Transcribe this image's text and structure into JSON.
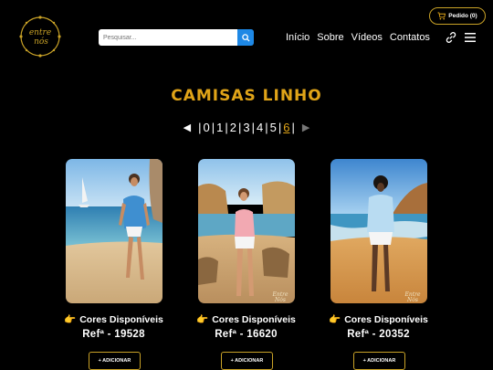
{
  "header": {
    "logo_text": "entre nós",
    "search_placeholder": "Pesquisar...",
    "nav": [
      "Início",
      "Sobre",
      "Vídeos",
      "Contatos"
    ],
    "order_label": "Pedido (0)"
  },
  "page": {
    "title": "CAMISAS LINHO",
    "pagination": {
      "pages": [
        "0",
        "1",
        "2",
        "3",
        "4",
        "5",
        "6"
      ],
      "current": "6",
      "separator": "|"
    }
  },
  "products": [
    {
      "colors_label": "Cores Disponíveis",
      "ref": "Refª - 19528",
      "add_label": "+ ADICIONAR"
    },
    {
      "colors_label": "Cores Disponíveis",
      "ref": "Refª - 16620",
      "add_label": "+ ADICIONAR"
    },
    {
      "colors_label": "Cores Disponíveis",
      "ref": "Refª - 20352",
      "add_label": "+ ADICIONAR"
    }
  ],
  "colors": {
    "accent": "#e0a418",
    "border": "#c9a227",
    "search_button": "#1e88e5",
    "background": "#000000"
  }
}
